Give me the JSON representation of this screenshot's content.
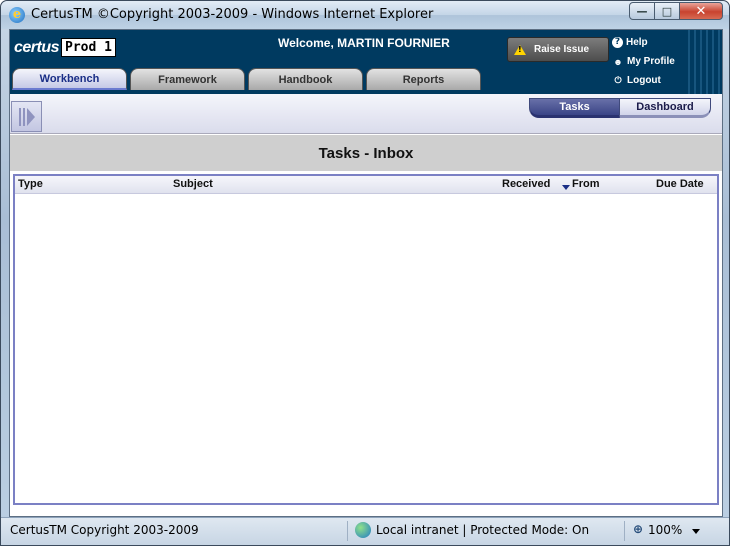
{
  "window": {
    "title": "CertusTM ©Copyright 2003-2009 - Windows Internet Explorer",
    "buttons": {
      "minimize": "—",
      "maximize": "□",
      "close": "✕"
    }
  },
  "header": {
    "logo_brand": "certus",
    "logo_env": "Prod 1",
    "welcome": "Welcome, MARTIN FOURNIER",
    "raise_issue": "Raise Issue",
    "links": {
      "help": "Help",
      "profile": "My Profile",
      "logout": "Logout"
    }
  },
  "tabs": [
    {
      "label": "Workbench",
      "active": true
    },
    {
      "label": "Framework",
      "active": false
    },
    {
      "label": "Handbook",
      "active": false
    },
    {
      "label": "Reports",
      "active": false
    }
  ],
  "view_toggle": {
    "tasks": "Tasks",
    "dashboard": "Dashboard",
    "active": "Tasks"
  },
  "inbox": {
    "title": "Tasks - Inbox",
    "columns": {
      "type": "Type",
      "subject": "Subject",
      "received": "Received",
      "from": "From",
      "due": "Due Date"
    },
    "sorted_by": "Received",
    "sort_direction": "descending",
    "rows": []
  },
  "statusbar": {
    "text": "CertusTM Copyright 2003-2009",
    "zone": "Local intranet | Protected Mode: On",
    "zoom": "100%"
  },
  "icons": {
    "browser": "ie-icon",
    "warning": "warning-icon",
    "help": "help-icon",
    "profile": "person-icon",
    "logout": "logout-icon",
    "zone": "globe-icon",
    "zoom": "magnifier-icon"
  }
}
